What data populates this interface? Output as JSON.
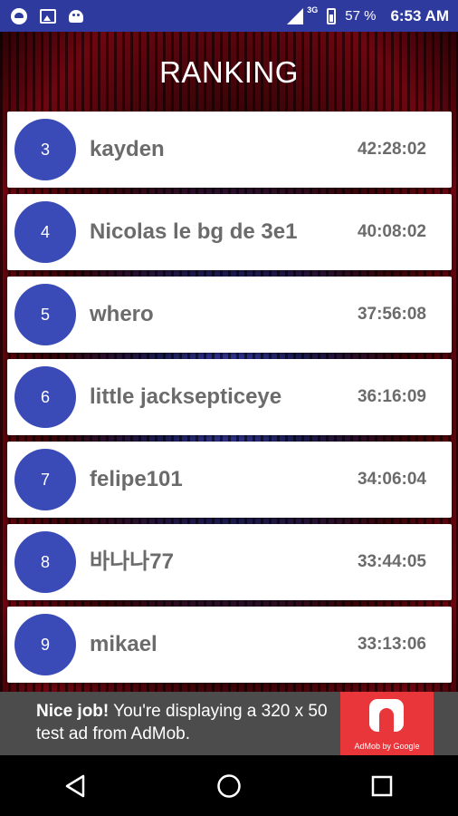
{
  "status_bar": {
    "icons_left": [
      "messenger-icon",
      "picture-icon",
      "android-icon"
    ],
    "network": "3G",
    "battery": "57 %",
    "time": "6:53 AM"
  },
  "title": "RANKING",
  "rankings": [
    {
      "rank": "3",
      "name": "kayden",
      "time": "42:28:02"
    },
    {
      "rank": "4",
      "name": "Nicolas le bg de 3e1",
      "time": "40:08:02"
    },
    {
      "rank": "5",
      "name": "whero",
      "time": "37:56:08"
    },
    {
      "rank": "6",
      "name": "little jacksepticeye",
      "time": "36:16:09"
    },
    {
      "rank": "7",
      "name": "felipe101",
      "time": "34:06:04"
    },
    {
      "rank": "8",
      "name": "바나나77",
      "time": "33:44:05"
    },
    {
      "rank": "9",
      "name": "mikael",
      "time": "33:13:06"
    }
  ],
  "ad": {
    "headline": "Nice job!",
    "body": " You're displaying a 320 x 50 test ad from AdMob.",
    "logo_caption": "AdMob by Google"
  },
  "colors": {
    "status_bar": "#2f3a9e",
    "badge": "#3a4bb8",
    "ad_logo": "#e8363a"
  },
  "nav": [
    "back-icon",
    "home-icon",
    "recents-icon"
  ]
}
